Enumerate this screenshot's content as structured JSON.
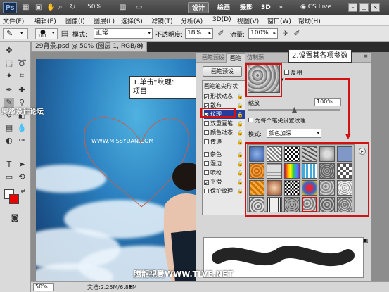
{
  "app": {
    "logo": "Ps",
    "zoom": "50%",
    "workspaces": [
      "设计",
      "绘画",
      "摄影",
      "3D"
    ],
    "cs_live": "CS Live",
    "window_controls": [
      "–",
      "□",
      "×"
    ]
  },
  "menubar": [
    "文件(F)",
    "编辑(E)",
    "图像(I)",
    "图层(L)",
    "选择(S)",
    "滤镜(T)",
    "分析(A)",
    "3D(D)",
    "视图(V)",
    "窗口(W)",
    "帮助(H)"
  ],
  "options": {
    "brush_size": "100",
    "mode_label": "模式:",
    "mode_value": "正常",
    "opacity_label": "不透明度:",
    "opacity_value": "18%",
    "flow_label": "流量:",
    "flow_value": "100%"
  },
  "document": {
    "tab_title": "29背景.psd @ 50% (图层 1, RGB/8) *",
    "zoom": "50%",
    "info": "文档:2.25M/6.82M"
  },
  "panel": {
    "tabs": [
      "画笔预设",
      "画笔",
      "仿制源"
    ],
    "preset_button": "画笔预设",
    "list_header": "画笔笔尖形状",
    "items": [
      {
        "label": "形状动态",
        "checked": true
      },
      {
        "label": "散布",
        "checked": true
      },
      {
        "label": "纹理",
        "checked": true
      },
      {
        "label": "双重画笔",
        "checked": false
      },
      {
        "label": "颜色动态",
        "checked": false
      },
      {
        "label": "传递",
        "checked": false
      },
      {
        "label": "杂色",
        "checked": false
      },
      {
        "label": "湿边",
        "checked": false
      },
      {
        "label": "喷枪",
        "checked": false
      },
      {
        "label": "平滑",
        "checked": true
      },
      {
        "label": "保护纹理",
        "checked": false
      }
    ],
    "invert": "反相",
    "scale_label": "缩放",
    "scale_value": "100%",
    "scale_fraction": 0.5,
    "each_tip": "为每个笔尖设置纹理",
    "mode_label": "模式:",
    "mode_value": "颜色加深"
  },
  "annotations": {
    "step1_line1": "1.单击“纹理”",
    "step1_line2": "项目",
    "step2": "2.设置其各项参数"
  },
  "watermarks": {
    "left": "思缘设计论坛",
    "center": "WWW.MISSYUAN.COM",
    "bottom": "腾龍視覺WWW.TLVE.NET"
  },
  "colors": {
    "highlight": "#253c9c",
    "annotation_red": "#d21212",
    "background_color": "#e00000"
  }
}
